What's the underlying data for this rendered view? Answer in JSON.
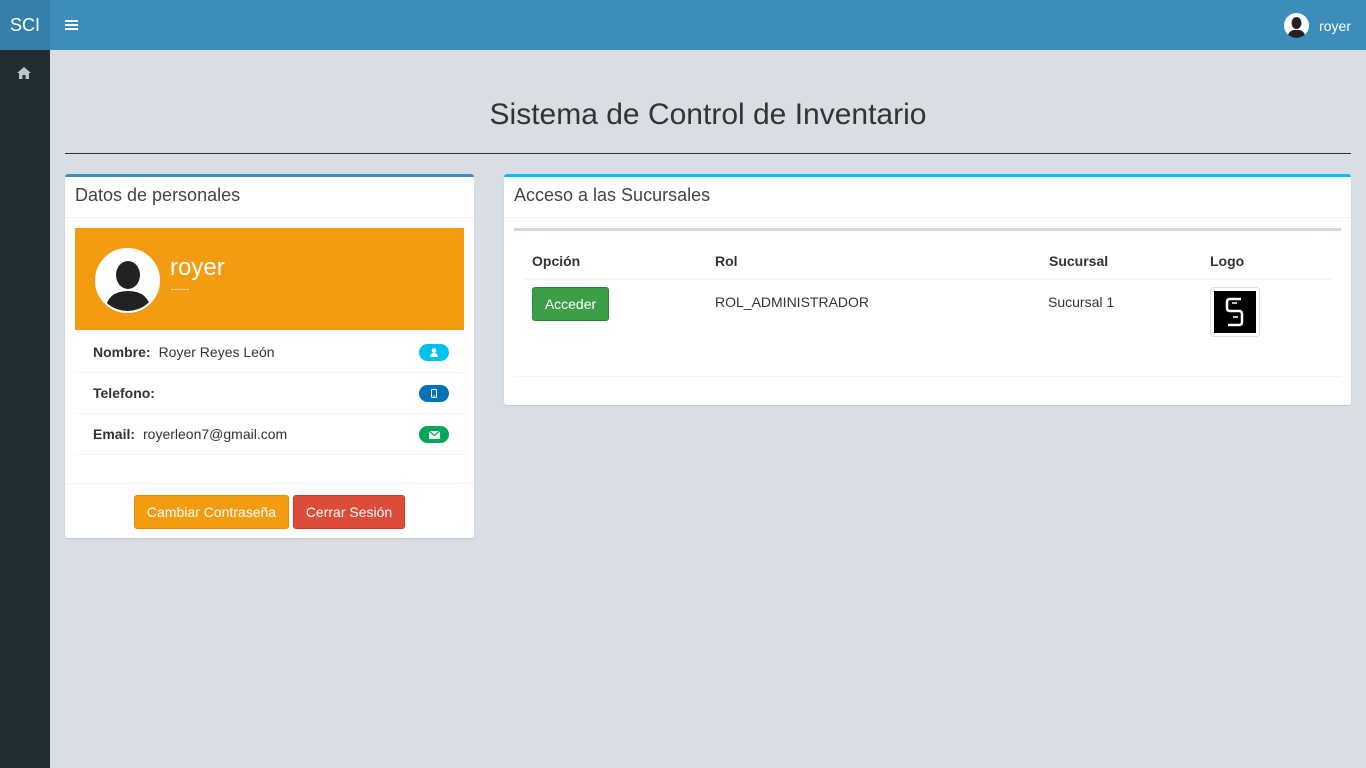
{
  "app": {
    "logo": "SCI",
    "user_name": "royer"
  },
  "page": {
    "title": "Sistema de Control de Inventario"
  },
  "personal": {
    "header": "Datos de personales",
    "name": "royer",
    "subtitle": "------",
    "rows": [
      {
        "label": "Nombre:",
        "value": "Royer Reyes León",
        "icon": "user-icon",
        "color": "#00c0ef"
      },
      {
        "label": "Telefono:",
        "value": "",
        "icon": "mobile-icon",
        "color": "#0073b7"
      },
      {
        "label": "Email:",
        "value": "royerleon7@gmail.com",
        "icon": "envelope-icon",
        "color": "#00a65a"
      }
    ],
    "change_password_label": "Cambiar Contraseña",
    "logout_label": "Cerrar Sesión"
  },
  "branches": {
    "header": "Acceso a las Sucursales",
    "columns": [
      "Opción",
      "Rol",
      "Sucursal",
      "Logo"
    ],
    "rows": [
      {
        "action_label": "Acceder",
        "role": "ROL_ADMINISTRADOR",
        "branch": "Sucursal 1",
        "logo_icon": "s-logo-icon"
      }
    ]
  },
  "colors": {
    "topbar": "#3c8dbc",
    "sidebar": "#222d32",
    "widget": "#f39c12",
    "danger": "#dd4b39",
    "success": "#3d9e48"
  }
}
